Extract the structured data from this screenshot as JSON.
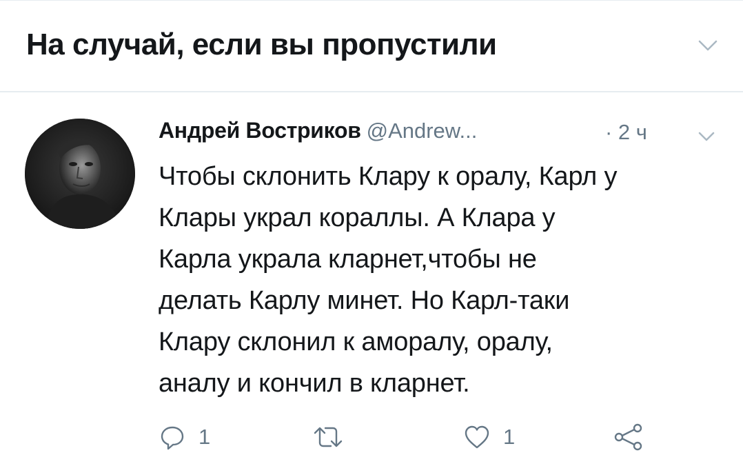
{
  "header": {
    "title": "На случай, если вы пропустили"
  },
  "tweet": {
    "author_name": "Андрей Востриков",
    "author_handle": "@Andrew...",
    "time": "· 2 ч",
    "text_lines": [
      "Чтобы склонить Клару к оралу, Карл у",
      "Клары украл кораллы. А Клара у",
      "Карла украла кларнет,чтобы не",
      "делать Карлу минет. Но Карл-таки",
      "Клару склонил к аморалу, оралу,",
      "аналу и кончил в кларнет."
    ],
    "actions": {
      "reply_count": "1",
      "retweet_count": "",
      "like_count": "1"
    }
  },
  "icons": {
    "header_menu": "chevron-down-icon",
    "tweet_menu": "chevron-down-icon",
    "reply": "reply-icon",
    "retweet": "retweet-icon",
    "like": "heart-icon",
    "share": "share-icon"
  },
  "colors": {
    "text_primary": "#14171a",
    "text_secondary": "#657786",
    "divider": "#e6ecf0"
  }
}
